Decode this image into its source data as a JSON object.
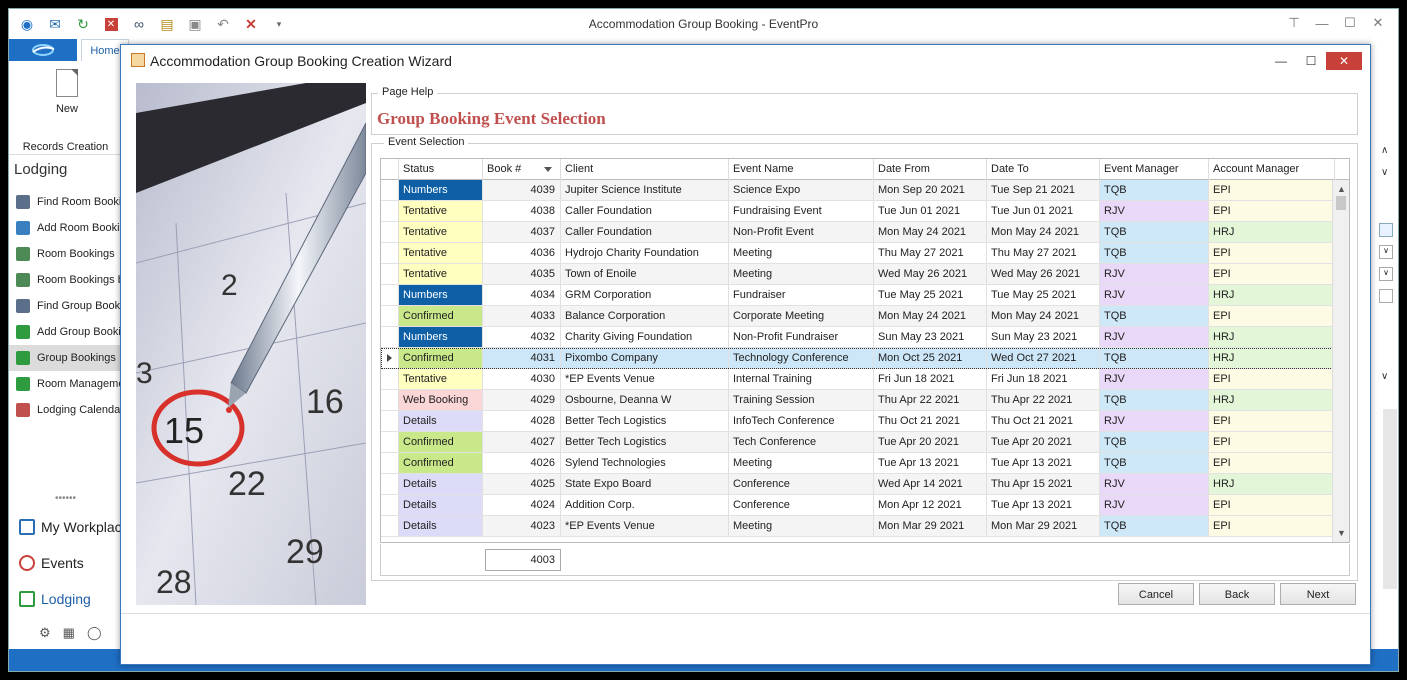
{
  "app": {
    "title": "Accommodation Group Booking - EventPro",
    "home_tab": "Home",
    "new_label": "New",
    "records_creation_label": "Records Creation",
    "lodging_header": "Lodging",
    "nav_items": [
      {
        "label": "Find Room Bookings",
        "icon": "binoculars-icon",
        "color": "#5b6f8a"
      },
      {
        "label": "Add Room Booking",
        "icon": "add-room-icon",
        "color": "#3a7fc0"
      },
      {
        "label": "Room Bookings",
        "icon": "room-bookings-icon",
        "color": "#4d8a55"
      },
      {
        "label": "Room Bookings by",
        "icon": "room-bookings-by-icon",
        "color": "#4d8a55"
      },
      {
        "label": "Find Group Bookings",
        "icon": "binoculars-icon",
        "color": "#5b6f8a"
      },
      {
        "label": "Add Group Booking",
        "icon": "add-group-icon",
        "color": "#2e9c3e"
      },
      {
        "label": "Group Bookings",
        "icon": "group-bookings-icon",
        "color": "#2e9c3e"
      },
      {
        "label": "Room Management",
        "icon": "room-management-icon",
        "color": "#2e9c3e"
      },
      {
        "label": "Lodging Calendar",
        "icon": "calendar-icon",
        "color": "#c0504d"
      }
    ],
    "module_items": [
      {
        "label": "My Workplace",
        "icon": "home-icon"
      },
      {
        "label": "Events",
        "icon": "pin-icon"
      },
      {
        "label": "Lodging",
        "icon": "lodging-icon"
      }
    ]
  },
  "dialog": {
    "title": "Accommodation Group Booking Creation Wizard",
    "page_help_legend": "Page Help",
    "page_title": "Group Booking Event Selection",
    "event_selection_legend": "Event Selection",
    "columns": [
      "Status",
      "Book #",
      "Client",
      "Event Name",
      "Date From",
      "Date To",
      "Event Manager",
      "Account Manager"
    ],
    "rows": [
      {
        "status": "Numbers",
        "book": "4039",
        "client": "Jupiter Science Institute",
        "event": "Science Expo",
        "from": "Mon Sep 20 2021",
        "to": "Tue Sep 21 2021",
        "em": "TQB",
        "am": "EPI"
      },
      {
        "status": "Tentative",
        "book": "4038",
        "client": "Caller Foundation",
        "event": "Fundraising Event",
        "from": "Tue Jun 01 2021",
        "to": "Tue Jun 01 2021",
        "em": "RJV",
        "am": "EPI"
      },
      {
        "status": "Tentative",
        "book": "4037",
        "client": "Caller Foundation",
        "event": "Non-Profit Event",
        "from": "Mon May 24 2021",
        "to": "Mon May 24 2021",
        "em": "TQB",
        "am": "HRJ"
      },
      {
        "status": "Tentative",
        "book": "4036",
        "client": "Hydrojo Charity Foundation",
        "event": "Meeting",
        "from": "Thu May 27 2021",
        "to": "Thu May 27 2021",
        "em": "TQB",
        "am": "EPI"
      },
      {
        "status": "Tentative",
        "book": "4035",
        "client": "Town of Enoile",
        "event": "Meeting",
        "from": "Wed May 26 2021",
        "to": "Wed May 26 2021",
        "em": "RJV",
        "am": "EPI"
      },
      {
        "status": "Numbers",
        "book": "4034",
        "client": "GRM Corporation",
        "event": "Fundraiser",
        "from": "Tue May 25 2021",
        "to": "Tue May 25 2021",
        "em": "RJV",
        "am": "HRJ"
      },
      {
        "status": "Confirmed",
        "book": "4033",
        "client": "Balance Corporation",
        "event": "Corporate Meeting",
        "from": "Mon May 24 2021",
        "to": "Mon May 24 2021",
        "em": "TQB",
        "am": "EPI"
      },
      {
        "status": "Numbers",
        "book": "4032",
        "client": "Charity Giving Foundation",
        "event": "Non-Profit Fundraiser",
        "from": "Sun May 23 2021",
        "to": "Sun May 23 2021",
        "em": "RJV",
        "am": "HRJ"
      },
      {
        "status": "Confirmed",
        "book": "4031",
        "client": "Pixombo Company",
        "event": "Technology Conference",
        "from": "Mon Oct 25 2021",
        "to": "Wed Oct 27 2021",
        "em": "TQB",
        "am": "HRJ",
        "selected": true
      },
      {
        "status": "Tentative",
        "book": "4030",
        "client": "*EP Events Venue",
        "event": "Internal Training",
        "from": "Fri Jun 18 2021",
        "to": "Fri Jun 18 2021",
        "em": "RJV",
        "am": "EPI"
      },
      {
        "status": "Web Booking",
        "book": "4029",
        "client": "Osbourne, Deanna W",
        "event": "Training Session",
        "from": "Thu Apr 22 2021",
        "to": "Thu Apr 22 2021",
        "em": "TQB",
        "am": "HRJ"
      },
      {
        "status": "Details",
        "book": "4028",
        "client": "Better Tech Logistics",
        "event": "InfoTech Conference",
        "from": "Thu Oct 21 2021",
        "to": "Thu Oct 21 2021",
        "em": "RJV",
        "am": "EPI"
      },
      {
        "status": "Confirmed",
        "book": "4027",
        "client": "Better Tech Logistics",
        "event": "Tech Conference",
        "from": "Tue Apr 20 2021",
        "to": "Tue Apr 20 2021",
        "em": "TQB",
        "am": "EPI"
      },
      {
        "status": "Confirmed",
        "book": "4026",
        "client": "Sylend Technologies",
        "event": "Meeting",
        "from": "Tue Apr 13 2021",
        "to": "Tue Apr 13 2021",
        "em": "TQB",
        "am": "EPI"
      },
      {
        "status": "Details",
        "book": "4025",
        "client": "State Expo Board",
        "event": "Conference",
        "from": "Wed Apr 14 2021",
        "to": "Thu Apr 15 2021",
        "em": "RJV",
        "am": "HRJ"
      },
      {
        "status": "Details",
        "book": "4024",
        "client": "Addition Corp.",
        "event": "Conference",
        "from": "Mon Apr 12 2021",
        "to": "Tue Apr 13 2021",
        "em": "RJV",
        "am": "EPI"
      },
      {
        "status": "Details",
        "book": "4023",
        "client": "*EP Events Venue",
        "event": "Meeting",
        "from": "Mon Mar 29 2021",
        "to": "Mon Mar 29 2021",
        "em": "TQB",
        "am": "EPI"
      }
    ],
    "footer_count": "4003",
    "buttons": {
      "cancel": "Cancel",
      "back": "Back",
      "next": "Next"
    },
    "calendar_numbers": [
      "2",
      "3",
      "15",
      "16",
      "22",
      "29",
      "28"
    ]
  },
  "colors": {
    "accent": "#1f6fc5",
    "page_title": "#c0504d",
    "Numbers": "#0e5fa6",
    "Tentative": "#ffffc0",
    "Confirmed": "#c9e88a",
    "Web Booking": "#fbd6d6",
    "Details": "#dcdcf8"
  }
}
